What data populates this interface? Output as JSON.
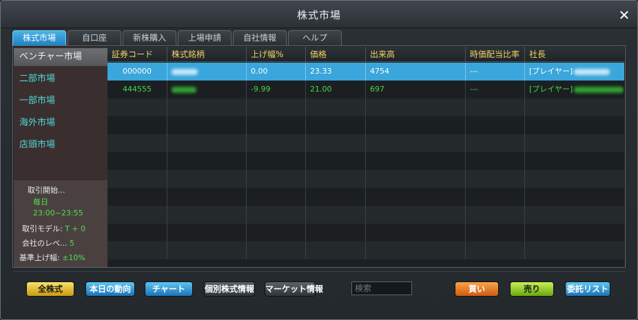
{
  "window": {
    "title": "株式市場",
    "close_label": "✕"
  },
  "tabs": [
    {
      "label": "株式市場",
      "active": true
    },
    {
      "label": "自口座",
      "active": false
    },
    {
      "label": "新株購入",
      "active": false
    },
    {
      "label": "上場申請",
      "active": false
    },
    {
      "label": "自社情報",
      "active": false
    },
    {
      "label": "ヘルプ",
      "active": false
    }
  ],
  "sidebar": {
    "markets": [
      {
        "label": "ベンチャー市場",
        "active": true
      },
      {
        "label": "二部市場",
        "active": false
      },
      {
        "label": "一部市場",
        "active": false
      },
      {
        "label": "海外市場",
        "active": false
      },
      {
        "label": "店頭市場",
        "active": false
      }
    ],
    "info": {
      "start_label": "取引開始...",
      "start_day": "毎日",
      "start_time": "23:00~23:55",
      "model_label": "取引モデル:",
      "model_value": "T + 0",
      "level_label": "会社のレベ...",
      "level_value": "5",
      "limit_label": "基準上げ幅:",
      "limit_value": "±10%"
    }
  },
  "table": {
    "columns": [
      "証券コード",
      "株式銘柄",
      "上げ幅%",
      "価格",
      "出来高",
      "時価配当比率",
      "社長"
    ],
    "rows": [
      {
        "code": "000000",
        "change": "0.00",
        "price": "23.33",
        "volume": "4754",
        "ratio": "---",
        "president": "[プレイヤー]",
        "selected": true
      },
      {
        "code": "444555",
        "change": "-9.99",
        "price": "21.00",
        "volume": "697",
        "ratio": "---",
        "president": "[プレイヤー]",
        "selected": false
      }
    ]
  },
  "footer": {
    "all_stocks": "全株式",
    "today_trend": "本日の動向",
    "chart": "チャート",
    "individual_info": "個別株式情報",
    "market_info": "マーケット情報",
    "search_placeholder": "検索",
    "buy": "買い",
    "sell": "売り",
    "order_list": "委託リスト"
  },
  "colors": {
    "accent_blue": "#3aa6db",
    "header_text": "#f1d36a",
    "sidebar_text": "#52d6d6",
    "positive_green": "#47d847"
  }
}
